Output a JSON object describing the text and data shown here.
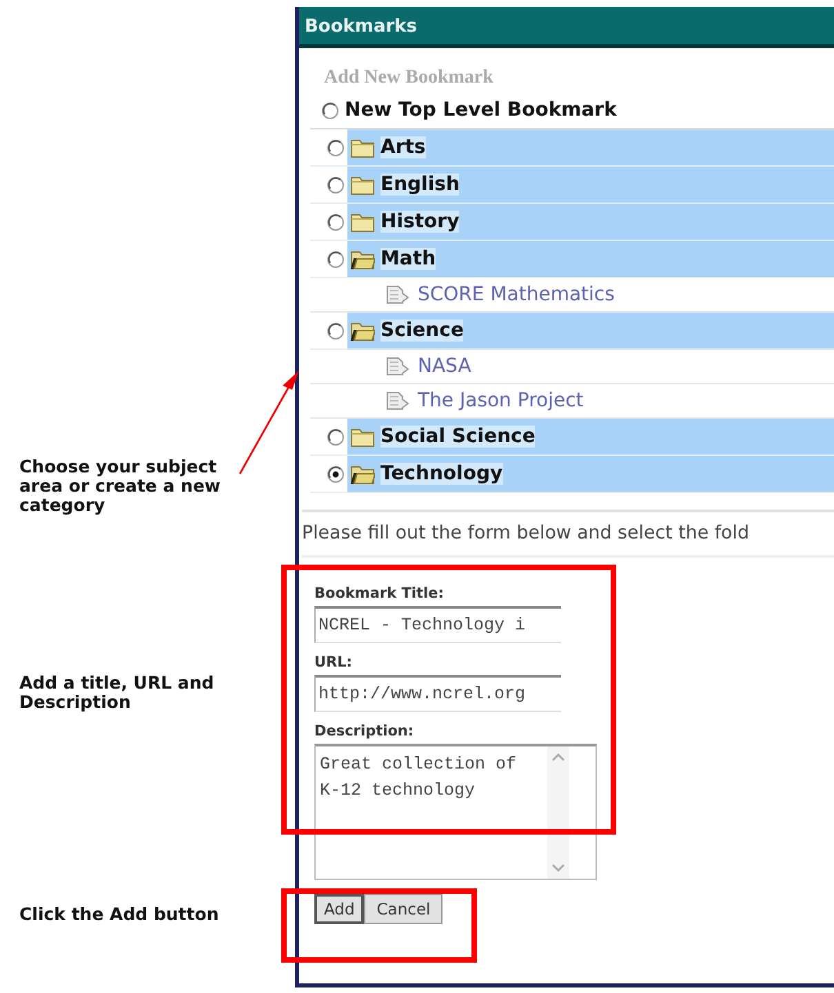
{
  "window": {
    "title": "Bookmarks"
  },
  "heading": "Add New Bookmark",
  "top_level": {
    "label": "New Top Level Bookmark",
    "selected": false
  },
  "folders": [
    {
      "label": "Arts",
      "selected": false,
      "expanded": false
    },
    {
      "label": "English",
      "selected": false,
      "expanded": false
    },
    {
      "label": "History",
      "selected": false,
      "expanded": false
    },
    {
      "label": "Math",
      "selected": false,
      "expanded": true,
      "bookmarks": [
        "SCORE Mathematics"
      ]
    },
    {
      "label": "Science",
      "selected": false,
      "expanded": true,
      "bookmarks": [
        "NASA",
        "The Jason Project"
      ]
    },
    {
      "label": "Social Science",
      "selected": false,
      "expanded": false
    },
    {
      "label": "Technology",
      "selected": true,
      "expanded": true
    }
  ],
  "instructions": "Please fill out the form below and select the fold",
  "fields": [
    {
      "kind": "input",
      "label": "Bookmark Title:",
      "value": "NCREL - Technology i"
    },
    {
      "kind": "input",
      "label": "URL:",
      "value": "http://www.ncrel.org"
    },
    {
      "kind": "textarea",
      "label": "Description:",
      "value": "Great collection of K-12 technology"
    }
  ],
  "buttons": [
    {
      "label": "Add",
      "focused": true
    },
    {
      "label": "Cancel",
      "focused": false
    }
  ],
  "callouts": [
    "Choose your subject area or create a new category",
    "Add a title, URL and Description",
    "Click the Add button"
  ]
}
